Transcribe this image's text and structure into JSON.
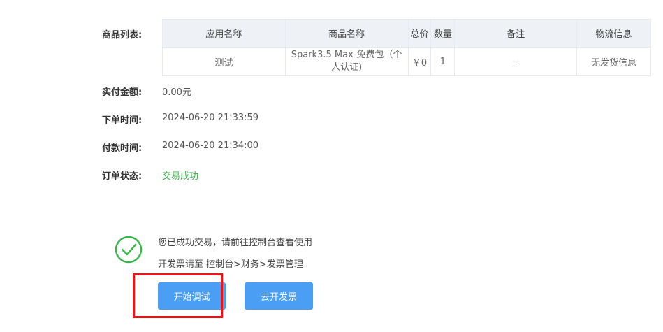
{
  "order": {
    "product_list_label": "商品列表:",
    "table": {
      "columns": [
        "应用名称",
        "商品名称",
        "总价",
        "数量",
        "备注",
        "物流信息"
      ],
      "rows": [
        [
          "测试",
          "Spark3.5 Max-免费包（个人认证)",
          "￥0",
          "1",
          "--",
          "无发货信息"
        ]
      ]
    },
    "paid_amount_label": "实付金额:",
    "paid_amount": "0.00元",
    "order_time_label": "下单时间:",
    "order_time": "2024-06-20 21:33:59",
    "payment_time_label": "付款时间:",
    "payment_time": "2024-06-20 21:34:00",
    "status_label": "订单状态:",
    "status": "交易成功",
    "status_color": "#3ab54a"
  },
  "success": {
    "icon": "check-circle-icon",
    "message": "您已成功交易，请前往控制台查看使用",
    "invoice_hint": "开发票请至 控制台>财务>发票管理",
    "start_debug_button": "开始调试",
    "invoice_button": "去开发票",
    "accent_color": "#4a9ff5",
    "highlight_color": "#e8161b"
  }
}
